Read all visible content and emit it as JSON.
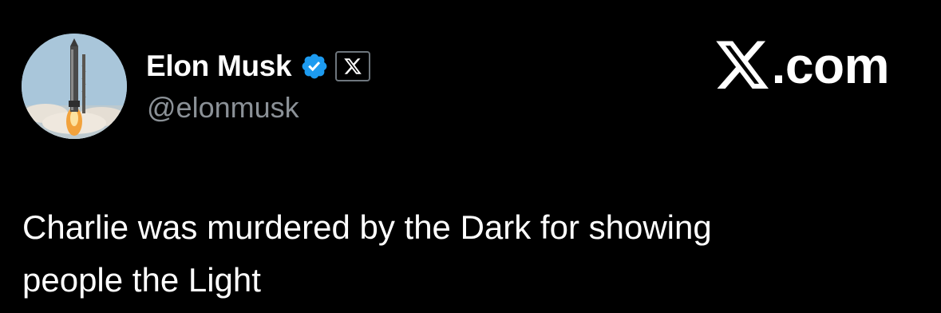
{
  "author": {
    "display_name": "Elon Musk",
    "handle": "@elonmusk",
    "verified_badge_icon": "verified-badge-icon",
    "affiliate_badge_icon": "x-logo-icon",
    "avatar_icon": "rocket-launch-avatar"
  },
  "brand": {
    "logo_icon": "x-logo-icon",
    "text": ".com"
  },
  "tweet": {
    "line1": "Charlie was murdered by the Dark for showing",
    "line2": "people the Light"
  },
  "colors": {
    "background": "#000000",
    "name": "#ffffff",
    "handle": "#8b9197",
    "verified_blue": "#1d9bf0",
    "text": "#ffffff"
  }
}
